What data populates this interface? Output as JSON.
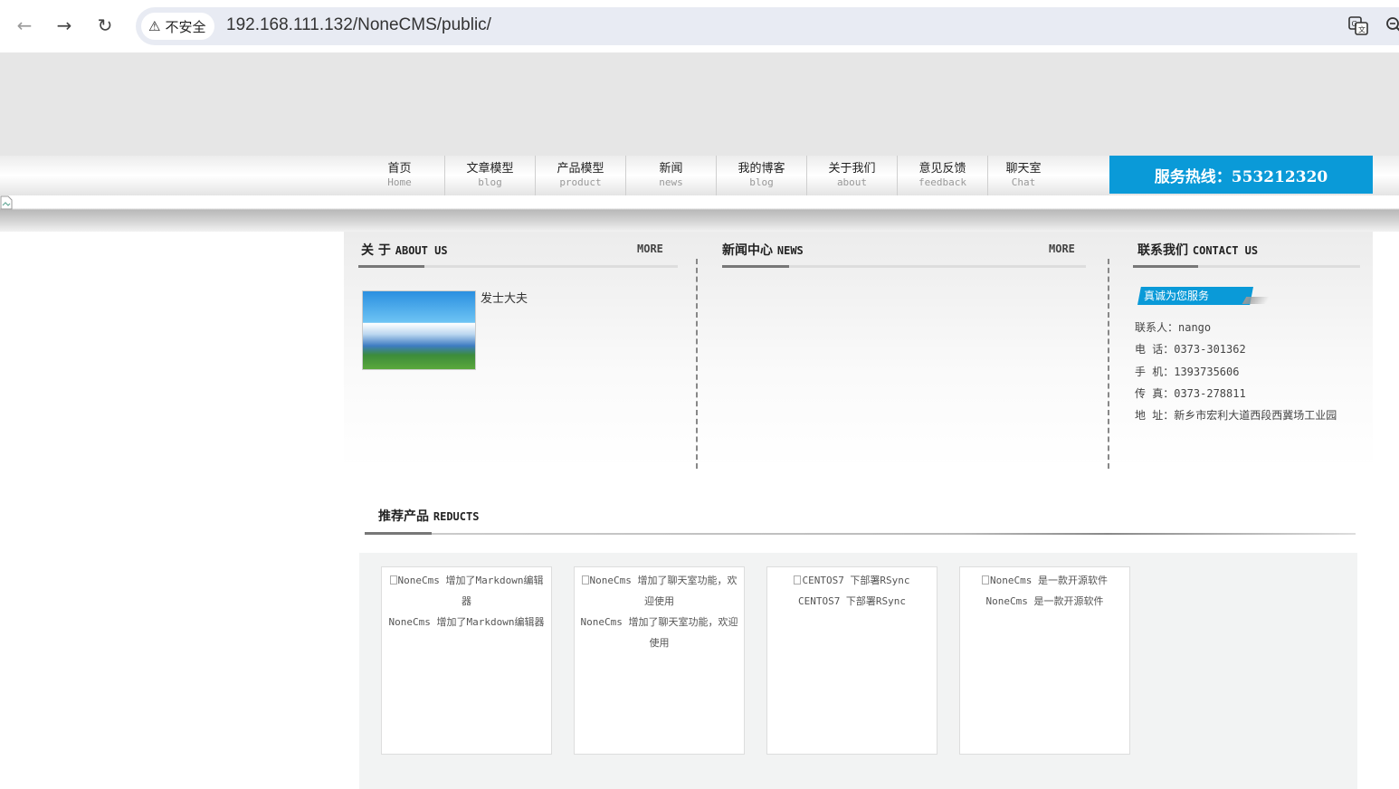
{
  "browser": {
    "security_label": "不安全",
    "url": "192.168.111.132/NoneCMS/public/"
  },
  "nav": {
    "items": [
      {
        "cn": "首页",
        "en": "Home"
      },
      {
        "cn": "文章模型",
        "en": "blog"
      },
      {
        "cn": "产品模型",
        "en": "product"
      },
      {
        "cn": "新闻",
        "en": "news"
      },
      {
        "cn": "我的博客",
        "en": "blog"
      },
      {
        "cn": "关于我们",
        "en": "about"
      },
      {
        "cn": "意见反馈",
        "en": "feedback"
      },
      {
        "cn": "聊天室",
        "en": "Chat"
      }
    ],
    "hotline": "服务热线：553212320"
  },
  "about": {
    "title_cn": "关 于",
    "title_en": "ABOUT US",
    "more": "MORE",
    "text": "发士大夫"
  },
  "news": {
    "title_cn": "新闻中心",
    "title_en": "NEWS",
    "more": "MORE"
  },
  "contact": {
    "title_cn": "联系我们",
    "title_en": "CONTACT US",
    "tag": "真诚为您服务",
    "lines": [
      "联系人：nango",
      "电  话：0373-301362",
      "手  机：1393735606",
      "传  真：0373-278811",
      "地  址：新乡市宏利大道西段西冀场工业园"
    ]
  },
  "products": {
    "title_cn": "推荐产品",
    "title_en": "REDUCTS",
    "items": [
      {
        "alt": "NoneCms 增加了Markdown编辑器",
        "title": "NoneCms 增加了Markdown编辑器"
      },
      {
        "alt": "NoneCms 增加了聊天室功能，欢迎使用",
        "title": "NoneCms 增加了聊天室功能，欢迎使用"
      },
      {
        "alt": "CENTOS7 下部署RSync",
        "title": "CENTOS7 下部署RSync"
      },
      {
        "alt": "NoneCms 是一款开源软件",
        "title": "NoneCms 是一款开源软件"
      }
    ]
  },
  "colors": {
    "accent": "#0a9ad8"
  }
}
